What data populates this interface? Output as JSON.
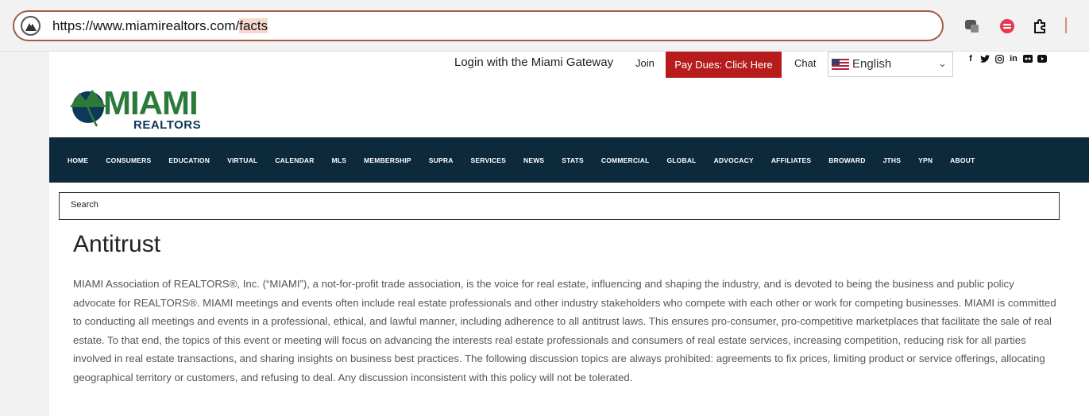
{
  "browser": {
    "url_prefix": "https://www.miamirealtors.com/",
    "url_highlight": "facts"
  },
  "topbar": {
    "login": "Login with the Miami Gateway",
    "join": "Join",
    "pay_dues": "Pay Dues: Click Here",
    "chat": "Chat",
    "language": "English",
    "socials": [
      "facebook-icon",
      "twitter-icon",
      "instagram-icon",
      "linkedin-icon",
      "flickr-icon",
      "youtube-icon"
    ]
  },
  "logo": {
    "main": "MIAMI",
    "sub": "REALTORS"
  },
  "nav": {
    "items": [
      "HOME",
      "CONSUMERS",
      "EDUCATION",
      "VIRTUAL",
      "CALENDAR",
      "MLS",
      "MEMBERSHIP",
      "SUPRA",
      "SERVICES",
      "NEWS",
      "STATS",
      "COMMERCIAL",
      "GLOBAL",
      "ADVOCACY",
      "AFFILIATES",
      "BROWARD",
      "JTHS",
      "YPN",
      "ABOUT"
    ]
  },
  "search": {
    "placeholder": "Search"
  },
  "content": {
    "title": "Antitrust",
    "paragraph": "MIAMI Association of REALTORS®, Inc. (“MIAMI”), a not-for-profit trade association, is the voice for real estate, influencing and shaping the industry, and is devoted to being the business and public policy advocate for REALTORS®. MIAMI meetings and events often include real estate professionals and other industry stakeholders who compete with each other or work for competing businesses. MIAMI is committed to conducting all meetings and events in a professional, ethical, and lawful manner, including adherence to all antitrust laws. This ensures pro-consumer, pro-competitive marketplaces that facilitate the sale of real estate. To that end, the topics of this event or meeting will focus on advancing the interests real estate professionals and consumers of real estate services, increasing competition, reducing risk for all parties involved in real estate transactions, and sharing insights on business best practices. The following discussion topics are always prohibited: agreements to fix prices, limiting product or service offerings, allocating geographical territory or customers, and refusing to deal. Any discussion inconsistent with this policy will not be tolerated."
  },
  "colors": {
    "nav_bg": "#0d2a3d",
    "pay_dues_bg": "#b71c1c",
    "logo_green": "#2c7a3a",
    "logo_blue": "#0d3858",
    "url_border": "#a45b43"
  }
}
